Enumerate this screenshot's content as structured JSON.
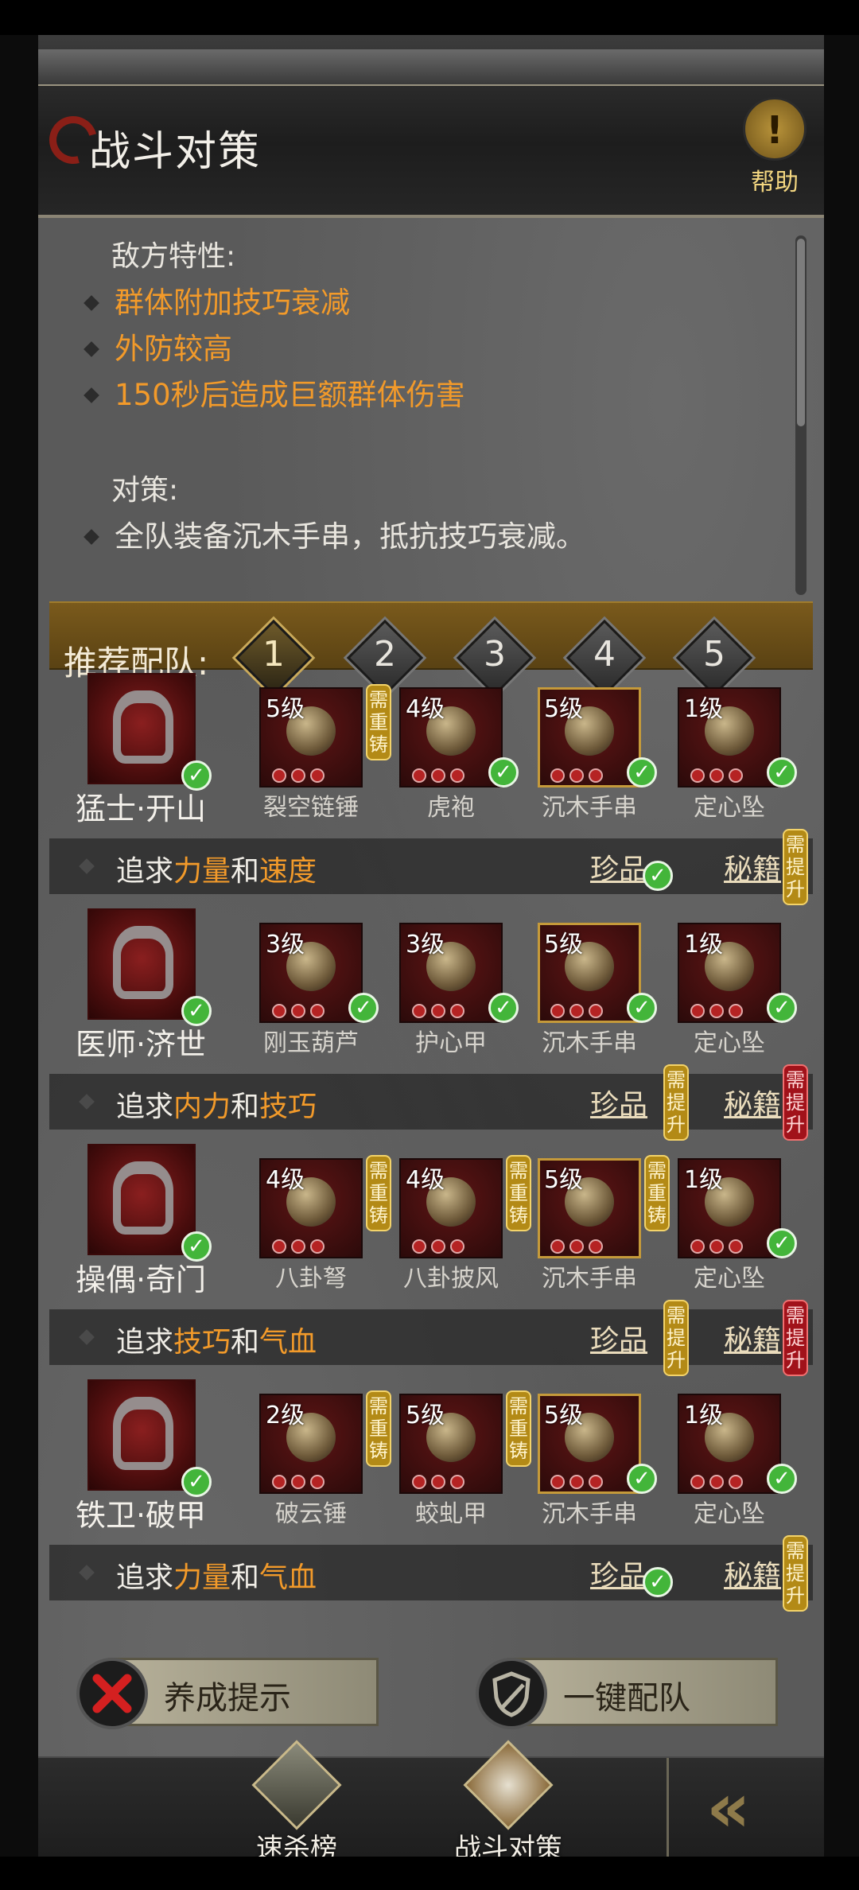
{
  "header": {
    "title": "战斗对策",
    "help_label": "帮助"
  },
  "intel": {
    "enemy_heading": "敌方特性:",
    "enemy_traits": [
      "群体附加技巧衰减",
      "外防较高",
      "150秒后造成巨额群体伤害"
    ],
    "counter_heading": "对策:",
    "counters": [
      "全队装备沉木手串，抵抗技巧衰减。"
    ]
  },
  "team": {
    "label": "推荐配队:",
    "tabs": [
      "1",
      "2",
      "3",
      "4",
      "5"
    ],
    "active_tab": "1"
  },
  "heroes": [
    {
      "name": "猛士·开山",
      "equipment": [
        {
          "level": "5级",
          "name": "裂空链锤",
          "tag": "需重铸"
        },
        {
          "level": "4级",
          "name": "虎袍",
          "tag": ""
        },
        {
          "level": "5级",
          "name": "沉木手串",
          "tag": ""
        },
        {
          "level": "1级",
          "name": "定心坠",
          "tag": ""
        }
      ],
      "goal": {
        "prefix": "追求",
        "attr1": "力量",
        "mid": "和",
        "attr2": "速度"
      },
      "treasure_label": "珍品",
      "manual_label": "秘籍",
      "manual_tag": "需提升"
    },
    {
      "name": "医师·济世",
      "equipment": [
        {
          "level": "3级",
          "name": "刚玉葫芦",
          "tag": ""
        },
        {
          "level": "3级",
          "name": "护心甲",
          "tag": ""
        },
        {
          "level": "5级",
          "name": "沉木手串",
          "tag": ""
        },
        {
          "level": "1级",
          "name": "定心坠",
          "tag": ""
        }
      ],
      "goal": {
        "prefix": "追求",
        "attr1": "内力",
        "mid": "和",
        "attr2": "技巧"
      },
      "treasure_label": "珍品",
      "treasure_tag": "需提升",
      "manual_label": "秘籍",
      "manual_tag": "需提升"
    },
    {
      "name": "操偶·奇门",
      "equipment": [
        {
          "level": "4级",
          "name": "八卦弩",
          "tag": "需重铸"
        },
        {
          "level": "4级",
          "name": "八卦披风",
          "tag": "需重铸"
        },
        {
          "level": "5级",
          "name": "沉木手串",
          "tag": "需重铸"
        },
        {
          "level": "1级",
          "name": "定心坠",
          "tag": ""
        }
      ],
      "goal": {
        "prefix": "追求",
        "attr1": "技巧",
        "mid": "和",
        "attr2": "气血"
      },
      "treasure_label": "珍品",
      "treasure_tag": "需提升",
      "manual_label": "秘籍",
      "manual_tag": "需提升"
    },
    {
      "name": "铁卫·破甲",
      "equipment": [
        {
          "level": "2级",
          "name": "破云锤",
          "tag": "需重铸"
        },
        {
          "level": "5级",
          "name": "蛟虬甲",
          "tag": "需重铸"
        },
        {
          "level": "5级",
          "name": "沉木手串",
          "tag": ""
        },
        {
          "level": "1级",
          "name": "定心坠",
          "tag": ""
        }
      ],
      "goal": {
        "prefix": "追求",
        "attr1": "力量",
        "mid": "和",
        "attr2": "气血"
      },
      "treasure_label": "珍品",
      "manual_label": "秘籍",
      "manual_tag": "需提升"
    }
  ],
  "actions": {
    "training_tips": "养成提示",
    "one_click_team": "一键配队"
  },
  "nav": {
    "speed_kill": "速杀榜",
    "battle_strategy": "战斗对策"
  },
  "colors": {
    "accent": "#f29a2a",
    "tag_gold": "#b38a16",
    "tag_red": "#a1121a",
    "check_green": "#43b53a"
  }
}
